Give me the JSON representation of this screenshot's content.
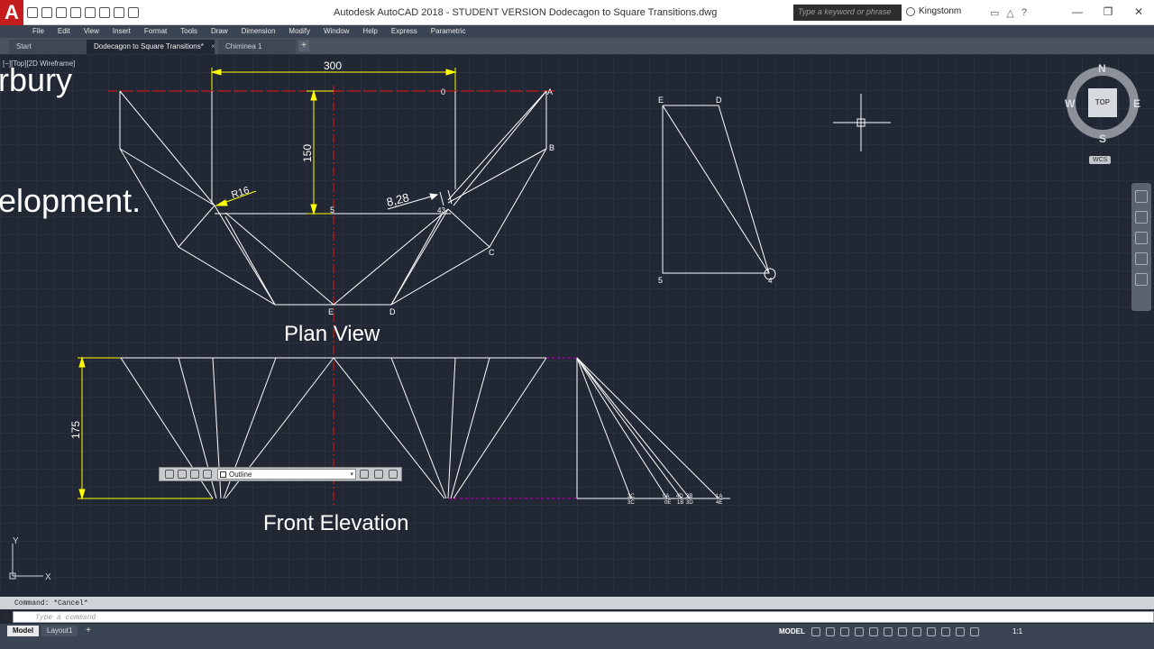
{
  "titlebar": {
    "app_title": "Autodesk AutoCAD 2018 - STUDENT VERSION    Dodecagon to Square Transitions.dwg",
    "search_placeholder": "Type a keyword or phrase",
    "user": "Kingstonm",
    "logo": "A"
  },
  "menu": [
    "File",
    "Edit",
    "View",
    "Insert",
    "Format",
    "Tools",
    "Draw",
    "Dimension",
    "Modify",
    "Window",
    "Help",
    "Express",
    "Parametric"
  ],
  "tabs": {
    "start": "Start",
    "doc1": "Dodecagon to Square Transitions*",
    "doc2": "Chiminea 1",
    "close": "×",
    "add": "+"
  },
  "viewport_label": "[−][Top][2D Wireframe]",
  "overlay_text": {
    "line1": "rbury",
    "line2": "elopment."
  },
  "drawing": {
    "plan_view": "Plan View",
    "front_elevation": "Front Elevation",
    "dim_300": "300",
    "dim_150": "150",
    "dim_175": "175",
    "dim_r16": "R16",
    "dim_828": "8,28",
    "labels": {
      "zero": "0",
      "A": "A",
      "B": "B",
      "C": "C",
      "D": "D",
      "E": "E",
      "five": "5",
      "fortythree": "43",
      "tri_E": "E",
      "tri_D": "D",
      "tri_5": "5",
      "tri_4": "4"
    },
    "elev_labels": [
      "3C",
      "3C",
      "0A",
      "0E",
      "4D",
      "1B",
      "2B",
      "3D",
      "1A",
      "4E"
    ]
  },
  "viewcube": {
    "top": "TOP",
    "north": "N",
    "south": "S",
    "east": "E",
    "west": "W",
    "wcs": "WCS"
  },
  "property_bar": {
    "layer_value": "Outline"
  },
  "ucs": {
    "x": "X",
    "y": "Y"
  },
  "command": {
    "history": "Command: *Cancel*",
    "placeholder": "Type a command"
  },
  "status": {
    "model_tab": "Model",
    "layout_tab": "Layout1",
    "add": "+",
    "model_btn": "MODEL",
    "scale": "1:1"
  },
  "colors": {
    "canvas_bg": "#222734",
    "geometry": "#ffffff",
    "dimension": "#ffff00",
    "centerline": "#ff0000",
    "hidden": "#c000c0",
    "autocad_red": "#c51d1d"
  }
}
